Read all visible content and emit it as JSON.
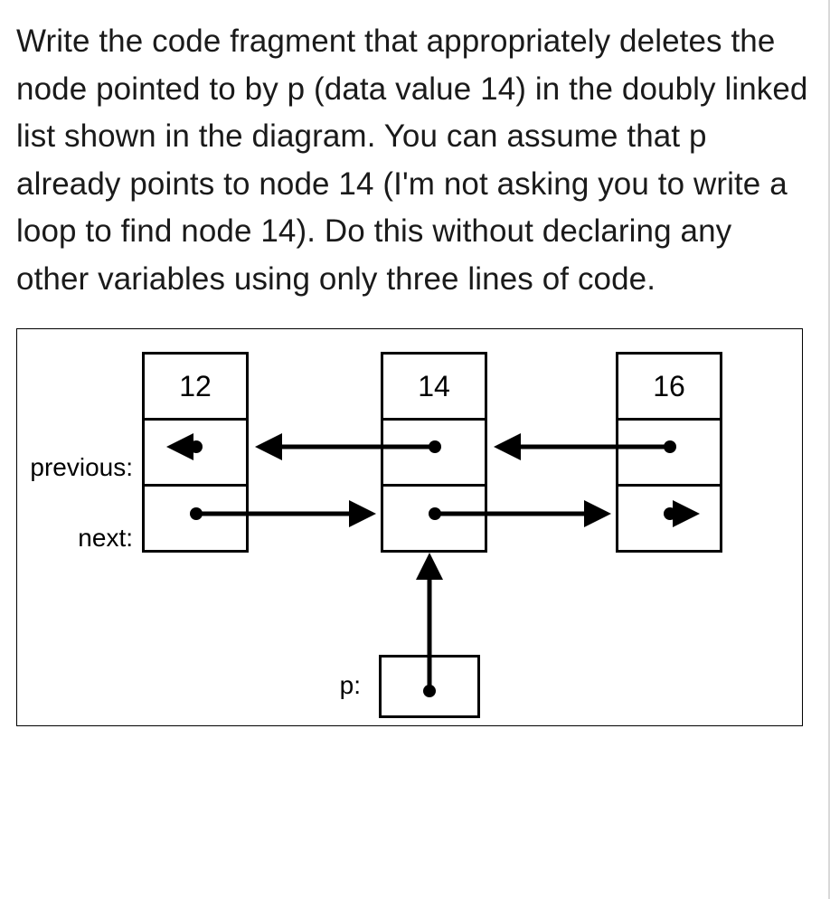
{
  "question": "Write the code fragment that appropriately deletes the node pointed to by p (data value 14) in the doubly linked list shown in the diagram. You can assume that p already points to node 14 (I'm not asking you to write a loop to find node 14). Do this without declaring any other variables using only three lines of code.",
  "labels": {
    "previous": "previous:",
    "next": "next:",
    "p": "p:"
  },
  "nodes": {
    "n1": "12",
    "n2": "14",
    "n3": "16"
  }
}
